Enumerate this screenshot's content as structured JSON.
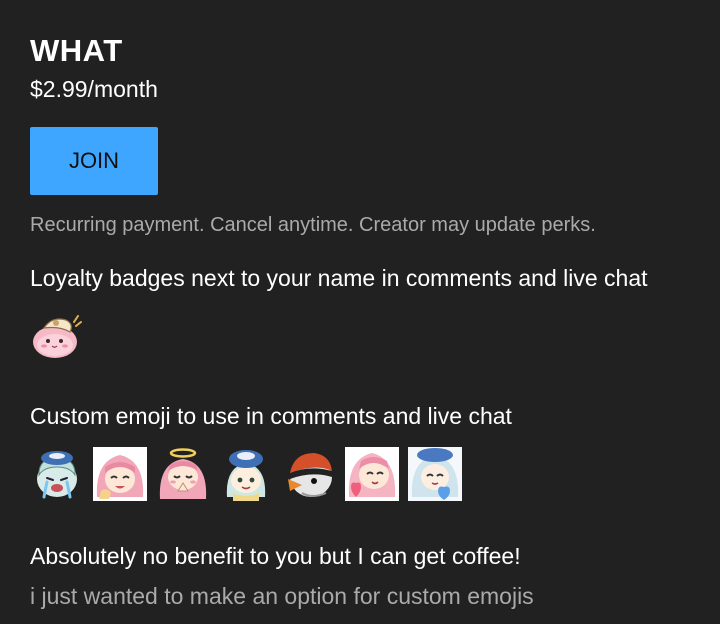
{
  "tier": {
    "name": "WHAT",
    "price": "$2.99/month"
  },
  "join": {
    "label": "JOIN"
  },
  "note": "Recurring payment. Cancel anytime. Creator may update perks.",
  "perks": [
    {
      "title": "Loyalty badges next to your name in comments and live chat",
      "icons": [
        "pink-blob-badge-icon"
      ]
    },
    {
      "title": "Custom emoji to use in comments and live chat",
      "icons": [
        "crying-girl-emoji-icon",
        "pink-hair-girl-emoji-icon",
        "halo-girl-emoji-icon",
        "blue-hat-girl-emoji-icon",
        "helmet-bird-emoji-icon",
        "heart-girl-emoji-icon",
        "blue-heart-girl-emoji-icon"
      ]
    },
    {
      "title": "Absolutely no benefit to you but I can get coffee!",
      "subtitle": "i just wanted to make an option for custom emojis"
    }
  ],
  "colors": {
    "background": "#212121",
    "accent": "#3ea6ff",
    "secondary_text": "#aaaaaa"
  }
}
